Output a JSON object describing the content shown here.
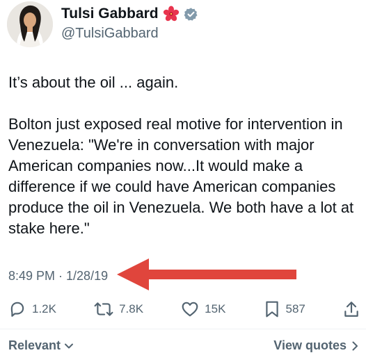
{
  "author": {
    "display_name": "Tulsi Gabbard",
    "handle": "@TulsiGabbard",
    "flower_emoji": "hibiscus",
    "verified_icon": "verified-badge-icon"
  },
  "tweet": {
    "paragraphs": [
      "It’s about the oil ... again.",
      "Bolton just exposed real motive for intervention in Venezuela: \"We're in conversation with major American companies now...It would make a difference if we could have American companies produce the oil in Venezuela. We both have a lot at stake here.\""
    ],
    "timestamp": "8:49 PM · 1/28/19"
  },
  "actions": {
    "replies": "1.2K",
    "retweets": "7.8K",
    "likes": "15K",
    "bookmarks": "587"
  },
  "footer": {
    "sort_label": "Relevant",
    "view_quotes_label": "View quotes"
  },
  "colors": {
    "text": "#0f1419",
    "secondary": "#536471",
    "verified": "#829aab",
    "arrow": "#e0453c",
    "hibiscus": "#e8344e"
  }
}
